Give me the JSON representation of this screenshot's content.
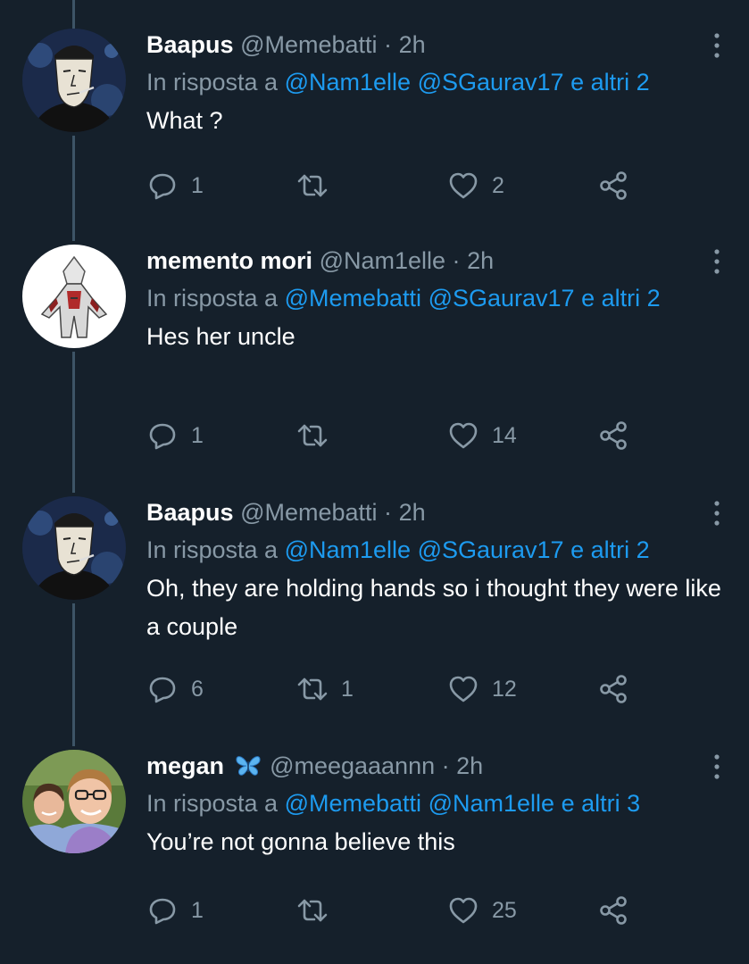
{
  "tweets": [
    {
      "name": "Baapus",
      "handle": "@Memebatti",
      "separator": "·",
      "time": "2h",
      "reply_prefix": "In risposta a",
      "mentions": [
        "@Nam1elle",
        "@SGaurav17",
        "e altri 2"
      ],
      "text": "What ?",
      "replies": "1",
      "retweets": "",
      "likes": "2",
      "avatar_icon": "wojak-avatar"
    },
    {
      "name": "memento mori",
      "handle": "@Nam1elle",
      "separator": "·",
      "time": "2h",
      "reply_prefix": "In risposta a",
      "mentions": [
        "@Memebatti",
        "@SGaurav17",
        "e altri 2"
      ],
      "text": "Hes her uncle",
      "replies": "1",
      "retweets": "",
      "likes": "14",
      "avatar_icon": "assassin-avatar"
    },
    {
      "name": "Baapus",
      "handle": "@Memebatti",
      "separator": "·",
      "time": "2h",
      "reply_prefix": "In risposta a",
      "mentions": [
        "@Nam1elle",
        "@SGaurav17",
        "e altri 2"
      ],
      "text": "Oh, they are holding hands so i thought they were like a couple",
      "replies": "6",
      "retweets": "1",
      "likes": "12",
      "avatar_icon": "wojak-avatar"
    },
    {
      "name": "megan",
      "name_emoji": "butterfly-icon",
      "handle": "@meegaaannn",
      "separator": "·",
      "time": "2h",
      "reply_prefix": "In risposta a",
      "mentions": [
        "@Memebatti",
        "@Nam1elle",
        "e altri 3"
      ],
      "text": "You’re not gonna believe this",
      "replies": "1",
      "retweets": "",
      "likes": "25",
      "avatar_icon": "photo-avatar"
    }
  ],
  "colors": {
    "background": "#15202b",
    "text_primary": "#ffffff",
    "text_secondary": "#8899a6",
    "mention": "#1d9bf0",
    "thread_line": "#3d5466"
  }
}
